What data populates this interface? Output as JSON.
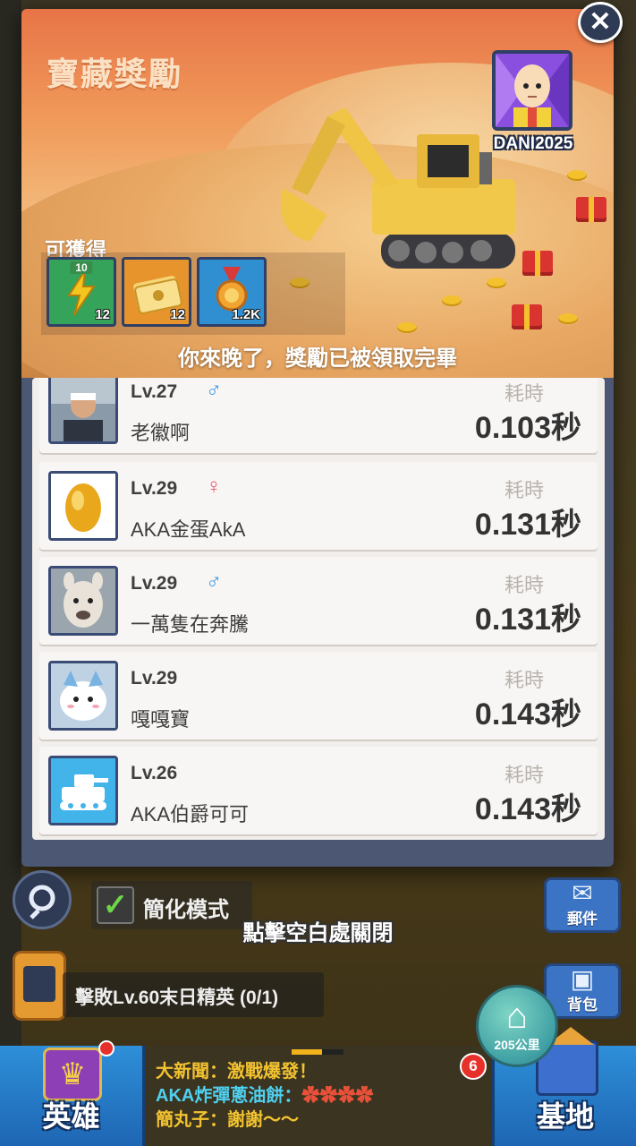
{
  "modal": {
    "title": "寶藏獎勵",
    "owner_name": "DANI2025",
    "obtain_label": "可獲得",
    "rewards": [
      {
        "icon": "energy-lightning-icon",
        "badge": "10",
        "qty": "12"
      },
      {
        "icon": "paw-ticket-icon",
        "badge": "",
        "qty": "12"
      },
      {
        "icon": "gold-medal-icon",
        "badge": "",
        "qty": "1.2K"
      }
    ],
    "notice": "你來晚了，獎勵已被領取完畢",
    "close_icon": "close-icon"
  },
  "ranking": {
    "time_label": "耗時",
    "rows": [
      {
        "level": "Lv.27",
        "gender": "male",
        "gender_symbol": "♂",
        "name": "老徽啊",
        "time": "0.103秒",
        "avatar": "photo-man-avatar"
      },
      {
        "level": "Lv.29",
        "gender": "female",
        "gender_symbol": "♀",
        "name": "AKA金蛋AkA",
        "time": "0.131秒",
        "avatar": "golden-egg-avatar"
      },
      {
        "level": "Lv.29",
        "gender": "male",
        "gender_symbol": "♂",
        "name": "一萬隻在奔騰",
        "time": "0.131秒",
        "avatar": "alpaca-avatar"
      },
      {
        "level": "Lv.29",
        "gender": "",
        "gender_symbol": "",
        "name": "嘎嘎寶",
        "time": "0.143秒",
        "avatar": "plush-toy-avatar"
      },
      {
        "level": "Lv.26",
        "gender": "",
        "gender_symbol": "",
        "name": "AKA伯爵可可",
        "time": "0.143秒",
        "avatar": "tank-avatar"
      }
    ]
  },
  "footer": {
    "simple_mode_label": "簡化模式",
    "simple_mode_checked": true,
    "close_hint": "點擊空白處關閉",
    "mail_label": "郵件",
    "bag_label": "背包",
    "quest_text": "擊敗Lv.60末日精英 (0/1)",
    "home_distance": "205公里",
    "base_badge": "6",
    "hero_label": "英雄",
    "base_label": "基地",
    "news": [
      "大新聞：激戰爆發！",
      "AKA炸彈蔥油餅：",
      "簡丸子：謝謝～～"
    ]
  },
  "colors": {
    "panel_bg": "#4c5774",
    "list_bg": "#f1eeeb",
    "male": "#3b96e6",
    "female": "#e8586f",
    "news_yellow": "#f2c230",
    "news_cyan": "#4fd0f0"
  }
}
